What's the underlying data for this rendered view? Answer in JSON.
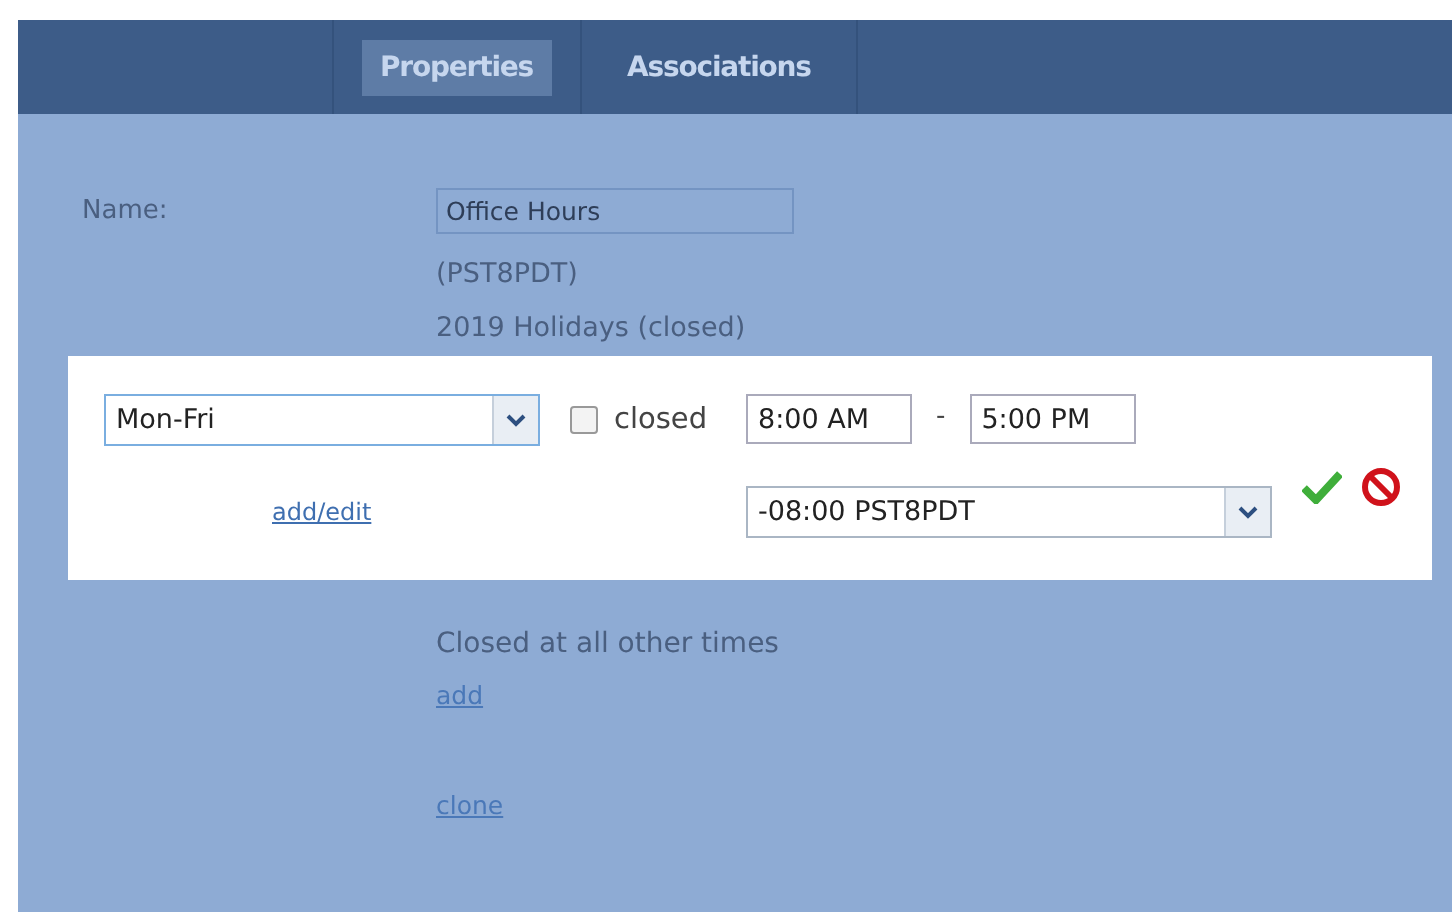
{
  "tabs": [
    {
      "label": "Properties",
      "selected": true
    },
    {
      "label": "Associations",
      "selected": false
    }
  ],
  "name_label": "Name:",
  "name_value": "Office Hours",
  "timezone_note": "(PST8PDT)",
  "holidays_note": "2019 Holidays (closed)",
  "schedule": {
    "days": "Mon-Fri",
    "closed_label": "closed",
    "closed": false,
    "start": "8:00 AM",
    "separator": "-",
    "end": "5:00 PM",
    "add_edit": "add/edit",
    "timezone": "-08:00 PST8PDT"
  },
  "other_times": "Closed at all other times",
  "links": [
    "add",
    "clone"
  ]
}
